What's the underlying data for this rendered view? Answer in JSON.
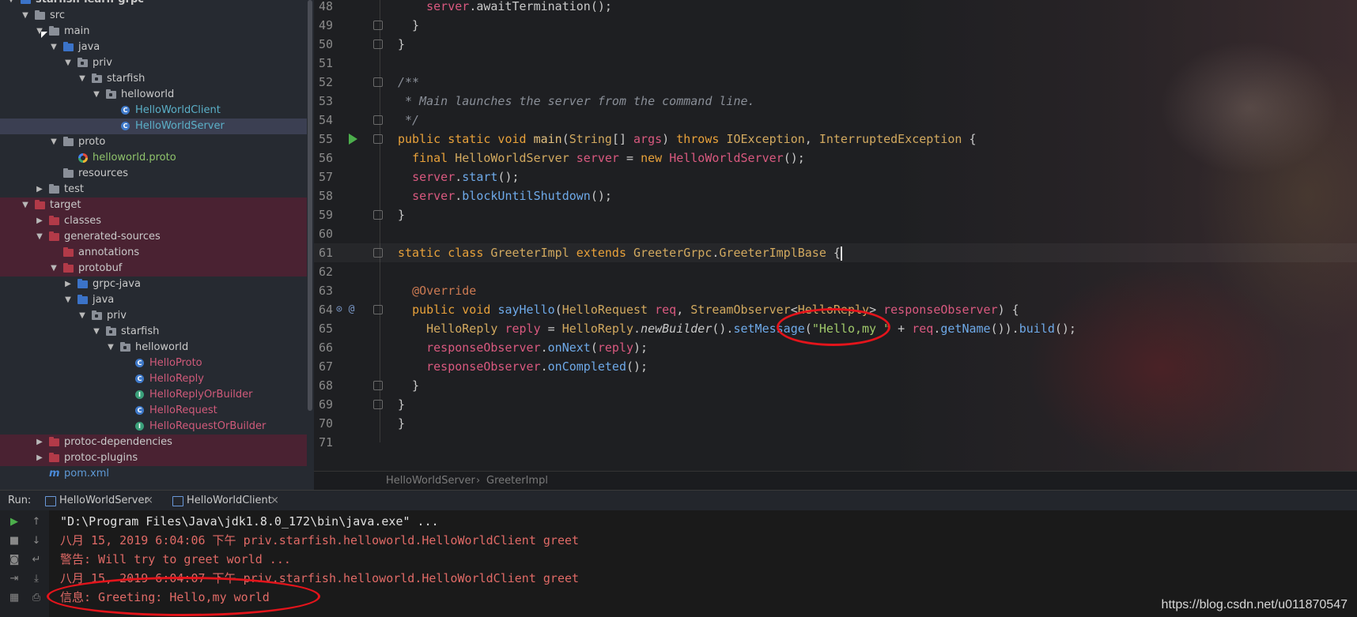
{
  "project_tree": {
    "items": [
      {
        "label": "starfish-learn-grpc",
        "depth": 0,
        "arrow": "down",
        "icon": "module",
        "bold": true
      },
      {
        "label": "src",
        "depth": 1,
        "arrow": "down",
        "icon": "grey"
      },
      {
        "label": "main",
        "depth": 2,
        "arrow": "down",
        "icon": "grey"
      },
      {
        "label": "java",
        "depth": 3,
        "arrow": "down",
        "icon": "blue"
      },
      {
        "label": "priv",
        "depth": 4,
        "arrow": "down",
        "icon": "pkg"
      },
      {
        "label": "starfish",
        "depth": 5,
        "arrow": "down",
        "icon": "pkg"
      },
      {
        "label": "helloworld",
        "depth": 6,
        "arrow": "down",
        "icon": "pkg"
      },
      {
        "label": "HelloWorldClient",
        "depth": 7,
        "icon": "class",
        "color": "#5bb0c8"
      },
      {
        "label": "HelloWorldServer",
        "depth": 7,
        "icon": "class",
        "color": "#5bb0c8",
        "selected": true
      },
      {
        "label": "proto",
        "depth": 3,
        "arrow": "down",
        "icon": "grey"
      },
      {
        "label": "helloworld.proto",
        "depth": 4,
        "icon": "proto",
        "color": "#8fc36b"
      },
      {
        "label": "resources",
        "depth": 3,
        "icon": "grey"
      },
      {
        "label": "test",
        "depth": 2,
        "arrow": "right",
        "icon": "grey"
      },
      {
        "label": "target",
        "depth": 1,
        "arrow": "down",
        "icon": "red",
        "red": true
      },
      {
        "label": "classes",
        "depth": 2,
        "arrow": "right",
        "icon": "red",
        "red": true
      },
      {
        "label": "generated-sources",
        "depth": 2,
        "arrow": "down",
        "icon": "red",
        "red": true
      },
      {
        "label": "annotations",
        "depth": 3,
        "icon": "red",
        "red": true
      },
      {
        "label": "protobuf",
        "depth": 3,
        "arrow": "down",
        "icon": "red",
        "red": true
      },
      {
        "label": "grpc-java",
        "depth": 4,
        "arrow": "right",
        "icon": "blue"
      },
      {
        "label": "java",
        "depth": 4,
        "arrow": "down",
        "icon": "blue"
      },
      {
        "label": "priv",
        "depth": 5,
        "arrow": "down",
        "icon": "pkg"
      },
      {
        "label": "starfish",
        "depth": 6,
        "arrow": "down",
        "icon": "pkg"
      },
      {
        "label": "helloworld",
        "depth": 7,
        "arrow": "down",
        "icon": "pkg"
      },
      {
        "label": "HelloProto",
        "depth": 8,
        "icon": "class",
        "color": "#d05a7a"
      },
      {
        "label": "HelloReply",
        "depth": 8,
        "icon": "class",
        "color": "#d05a7a"
      },
      {
        "label": "HelloReplyOrBuilder",
        "depth": 8,
        "icon": "interface",
        "color": "#d05a7a"
      },
      {
        "label": "HelloRequest",
        "depth": 8,
        "icon": "class",
        "color": "#d05a7a"
      },
      {
        "label": "HelloRequestOrBuilder",
        "depth": 8,
        "icon": "interface",
        "color": "#d05a7a"
      },
      {
        "label": "protoc-dependencies",
        "depth": 2,
        "arrow": "right",
        "icon": "red",
        "red": true
      },
      {
        "label": "protoc-plugins",
        "depth": 2,
        "arrow": "right",
        "icon": "red",
        "red": true
      },
      {
        "label": "pom.xml",
        "depth": 2,
        "icon": "maven",
        "color": "#5f9ad6"
      }
    ]
  },
  "editor": {
    "lines": [
      {
        "n": "48",
        "html": "    <span class='var'>server</span>.awaitTermination();"
      },
      {
        "n": "49",
        "html": "  }"
      },
      {
        "n": "50",
        "html": "}"
      },
      {
        "n": "51",
        "html": ""
      },
      {
        "n": "52",
        "html": "<span class='cm'>/**</span>"
      },
      {
        "n": "53",
        "html": "<span class='cm'> * Main launches the server from the command line.</span>"
      },
      {
        "n": "54",
        "html": "<span class='cm'> */</span>"
      },
      {
        "n": "55",
        "html": "<span class='kw'>public static void</span> <span class='fn'>main</span>(<span class='cls'>String</span>[] <span class='var'>args</span>) <span class='kw'>throws</span> <span class='cls'>IOException</span>, <span class='cls'>InterruptedException</span> {"
      },
      {
        "n": "56",
        "html": "  <span class='kw'>final</span> <span class='cls'>HelloWorldServer</span> <span class='var'>server</span> = <span class='kw'>new</span> <span class='var'>HelloWorldServer</span>();"
      },
      {
        "n": "57",
        "html": "  <span class='var'>server</span>.<span class='meth'>start</span>();"
      },
      {
        "n": "58",
        "html": "  <span class='var'>server</span>.<span class='meth'>blockUntilShutdown</span>();"
      },
      {
        "n": "59",
        "html": "}"
      },
      {
        "n": "60",
        "html": ""
      },
      {
        "n": "61",
        "html": "<span class='kw'>static class</span> <span class='cls'>GreeterImpl</span> <span class='kw'>extends</span> <span class='cls'>GreeterGrpc</span>.<span class='cls'>GreeterImplBase</span> {"
      },
      {
        "n": "62",
        "html": ""
      },
      {
        "n": "63",
        "html": "  <span class='ann'>@Override</span>"
      },
      {
        "n": "64",
        "html": "  <span class='kw'>public void</span> <span class='meth'>sayHello</span>(<span class='cls'>HelloRequest</span> <span class='var'>req</span>, <span class='cls'>StreamObserver</span>&lt;<span class='cls'>HelloReply</span>&gt; <span class='var'>responseObserver</span>) {"
      },
      {
        "n": "65",
        "html": "    <span class='cls'>HelloReply</span> <span class='var'>reply</span> = <span class='cls'>HelloReply</span>.<span class='ital'>newBuilder</span>().<span class='meth'>setMessage</span>(<span class='str'>\"Hello,my \"</span> + <span class='var'>req</span>.<span class='meth'>getName</span>()).<span class='meth'>build</span>();"
      },
      {
        "n": "66",
        "html": "    <span class='var'>responseObserver</span>.<span class='meth'>onNext</span>(<span class='var'>reply</span>);"
      },
      {
        "n": "67",
        "html": "    <span class='var'>responseObserver</span>.<span class='meth'>onCompleted</span>();"
      },
      {
        "n": "68",
        "html": "  }"
      },
      {
        "n": "69",
        "html": "}"
      },
      {
        "n": "70",
        "html": "}"
      },
      {
        "n": "71",
        "html": ""
      }
    ],
    "breadcrumb_class": "HelloWorldServer",
    "breadcrumb_sep": "›",
    "breadcrumb_inner": "GreeterImpl"
  },
  "run_panel": {
    "label": "Run:",
    "tabs": [
      "HelloWorldServer",
      "HelloWorldClient"
    ],
    "close_glyph": "×",
    "console": [
      {
        "text": "\"D:\\Program Files\\Java\\jdk1.8.0_172\\bin\\java.exe\" ...",
        "color": "white"
      },
      {
        "text": "八月 15, 2019 6:04:06 下午 priv.starfish.helloworld.HelloWorldClient greet",
        "color": "red"
      },
      {
        "text": "警告: Will try to greet world ...",
        "color": "red"
      },
      {
        "text": "八月 15, 2019 6:04:07 下午 priv.starfish.helloworld.HelloWorldClient greet",
        "color": "red"
      },
      {
        "text": "信息: Greeting: Hello,my world",
        "color": "red"
      }
    ]
  },
  "watermark": "https://blog.csdn.net/u011870547"
}
